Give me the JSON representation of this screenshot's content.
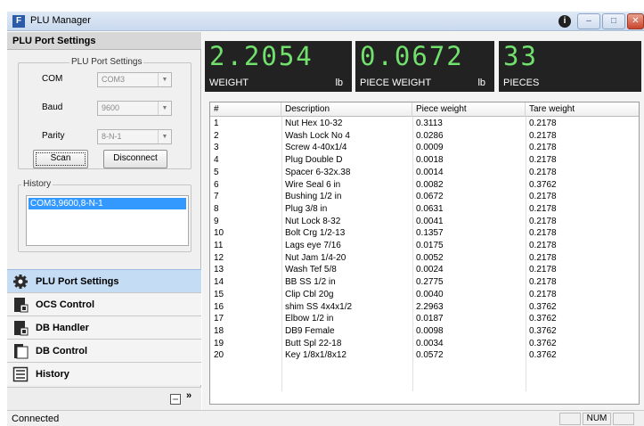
{
  "window": {
    "title": "PLU Manager",
    "icon": "F",
    "help_glyph": "i",
    "min_glyph": "–",
    "max_glyph": "□",
    "close_glyph": "✕"
  },
  "left_panel": {
    "header": "PLU Port Settings",
    "port_group": {
      "legend": "PLU Port Settings",
      "com_label": "COM",
      "com_value": "COM3",
      "baud_label": "Baud",
      "baud_value": "9600",
      "parity_label": "Parity",
      "parity_value": "8-N-1",
      "scan_label": "Scan",
      "disconnect_label": "Disconnect"
    },
    "history_group": {
      "legend": "History",
      "items": [
        "COM3,9600,8-N-1"
      ]
    },
    "nav": [
      {
        "label": "PLU Port Settings",
        "icon": "gear-icon",
        "active": true
      },
      {
        "label": "OCS Control",
        "icon": "ocs-control-icon",
        "active": false
      },
      {
        "label": "DB Handler",
        "icon": "db-handler-icon",
        "active": false
      },
      {
        "label": "DB Control",
        "icon": "db-control-icon",
        "active": false
      },
      {
        "label": "History",
        "icon": "history-icon",
        "active": false
      }
    ],
    "footer": {
      "chevron": "»"
    }
  },
  "displays": [
    {
      "value": "2.2054",
      "label": "WEIGHT",
      "unit": "lb"
    },
    {
      "value": "0.0672",
      "label": "PIECE WEIGHT",
      "unit": "lb"
    },
    {
      "value": "33",
      "label": "PIECES",
      "unit": ""
    }
  ],
  "table": {
    "columns": [
      "#",
      "Description",
      "Piece weight",
      "Tare weight"
    ],
    "rows": [
      [
        "1",
        "Nut Hex 10-32",
        "0.3113",
        "0.2178"
      ],
      [
        "2",
        "Wash Lock No 4",
        "0.0286",
        "0.2178"
      ],
      [
        "3",
        "Screw 4-40x1/4",
        "0.0009",
        "0.2178"
      ],
      [
        "4",
        "Plug Double D",
        "0.0018",
        "0.2178"
      ],
      [
        "5",
        "Spacer 6-32x.38",
        "0.0014",
        "0.2178"
      ],
      [
        "6",
        "Wire Seal 6 in",
        "0.0082",
        "0.3762"
      ],
      [
        "7",
        "Bushing 1/2 in",
        "0.0672",
        "0.2178"
      ],
      [
        "8",
        "Plug 3/8 in",
        "0.0631",
        "0.2178"
      ],
      [
        "9",
        "Nut Lock 8-32",
        "0.0041",
        "0.2178"
      ],
      [
        "10",
        "Bolt Crg 1/2-13",
        "0.1357",
        "0.2178"
      ],
      [
        "11",
        "Lags eye 7/16",
        "0.0175",
        "0.2178"
      ],
      [
        "12",
        "Nut Jam 1/4-20",
        "0.0052",
        "0.2178"
      ],
      [
        "13",
        "Wash Tef 5/8",
        "0.0024",
        "0.2178"
      ],
      [
        "14",
        "BB SS 1/2 in",
        "0.2775",
        "0.2178"
      ],
      [
        "15",
        "Clip Cbl 20g",
        "0.0040",
        "0.2178"
      ],
      [
        "16",
        "shim SS 4x4x1/2",
        "2.2963",
        "0.3762"
      ],
      [
        "17",
        "Elbow 1/2 in",
        "0.0187",
        "0.3762"
      ],
      [
        "18",
        "DB9 Female",
        "0.0098",
        "0.3762"
      ],
      [
        "19",
        "Butt Spl 22-18",
        "0.0034",
        "0.3762"
      ],
      [
        "20",
        "Key 1/8x1/8x12",
        "0.0572",
        "0.3762"
      ]
    ]
  },
  "statusbar": {
    "text": "Connected",
    "num": "NUM"
  }
}
